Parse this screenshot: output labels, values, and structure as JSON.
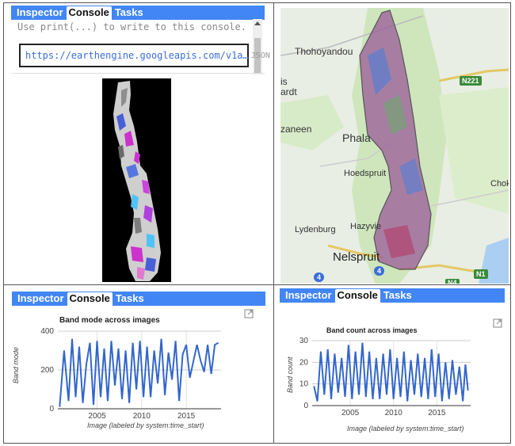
{
  "tabs": {
    "inspector": "Inspector",
    "console": "Console",
    "tasks": "Tasks"
  },
  "console_top": {
    "hint": "Use print(...) to write to this console.",
    "url": "https://earthengine.googleapis.com/v1a…",
    "json_tag": "JSON"
  },
  "map": {
    "labels": {
      "thohoyandou": "Thohoyandou",
      "is": "is",
      "ardt": "ardt",
      "zaneen": "zaneen",
      "phala": "Phala",
      "hoedspruit": "Hoedspruit",
      "lydenburg": "Lydenburg",
      "hazyview": "Hazyvie",
      "nelspruit": "Nelspruit",
      "chok": "Chok"
    },
    "shields": {
      "n221": "N221",
      "n4": "N4",
      "n1": "N1",
      "r4a": "4",
      "r4b": "4"
    }
  },
  "chart_mode": {
    "chart_data": {
      "type": "line",
      "title": "Band mode across images",
      "xlabel": "Image (labeled by system:time_start)",
      "ylabel": "Band mode",
      "ylim": [
        0,
        400
      ],
      "yticks": [
        0,
        200,
        400
      ],
      "xticks": [
        2005,
        2010,
        2015
      ],
      "xlim": [
        2000.6,
        2018.9
      ],
      "color": "#3366cc",
      "x": [
        2000.8,
        2001.3,
        2001.8,
        2002.2,
        2002.6,
        2003.0,
        2003.4,
        2003.8,
        2004.2,
        2004.6,
        2005.0,
        2005.4,
        2005.8,
        2006.2,
        2006.6,
        2007.0,
        2007.4,
        2007.8,
        2008.2,
        2008.6,
        2009.0,
        2009.4,
        2009.8,
        2010.2,
        2010.6,
        2011.0,
        2011.4,
        2011.8,
        2012.2,
        2012.6,
        2013.0,
        2013.4,
        2013.8,
        2014.2,
        2014.6,
        2015.0,
        2015.4,
        2016.2,
        2016.6,
        2017.0,
        2017.4,
        2017.8,
        2018.2,
        2018.6
      ],
      "y": [
        10,
        300,
        40,
        360,
        60,
        320,
        30,
        230,
        340,
        20,
        350,
        60,
        310,
        40,
        350,
        120,
        310,
        50,
        300,
        30,
        340,
        100,
        350,
        60,
        320,
        60,
        300,
        130,
        360,
        70,
        290,
        150,
        350,
        40,
        280,
        330,
        160,
        330,
        250,
        190,
        330,
        180,
        330,
        340
      ]
    }
  },
  "chart_count": {
    "chart_data": {
      "type": "line",
      "title": "Band count across images",
      "xlabel": "Image (labeled by system:time_start)",
      "ylabel": "Band count",
      "ylim": [
        0,
        30
      ],
      "yticks": [
        0,
        10,
        20,
        30
      ],
      "xticks": [
        2005,
        2010,
        2015
      ],
      "xlim": [
        2000.6,
        2018.9
      ],
      "color": "#3366cc",
      "x": [
        2000.8,
        2001.2,
        2001.6,
        2002.0,
        2002.4,
        2002.8,
        2003.2,
        2003.6,
        2004.0,
        2004.4,
        2004.8,
        2005.2,
        2005.6,
        2006.0,
        2006.4,
        2006.8,
        2007.2,
        2007.6,
        2008.0,
        2008.4,
        2008.8,
        2009.2,
        2009.6,
        2010.0,
        2010.4,
        2010.8,
        2011.2,
        2011.6,
        2012.0,
        2012.4,
        2012.8,
        2013.2,
        2013.6,
        2014.0,
        2014.4,
        2014.8,
        2015.2,
        2015.6,
        2016.0,
        2016.4,
        2016.8,
        2017.2,
        2017.6,
        2018.0,
        2018.3,
        2018.6
      ],
      "y": [
        9,
        2,
        25,
        5,
        26,
        3,
        24,
        6,
        22,
        4,
        28,
        3,
        25,
        5,
        29,
        4,
        25,
        3,
        22,
        3,
        24,
        5,
        26,
        3,
        22,
        4,
        25,
        2,
        21,
        5,
        24,
        4,
        22,
        3,
        26,
        4,
        24,
        2,
        20,
        3,
        21,
        5,
        18,
        2,
        19,
        7
      ]
    }
  }
}
